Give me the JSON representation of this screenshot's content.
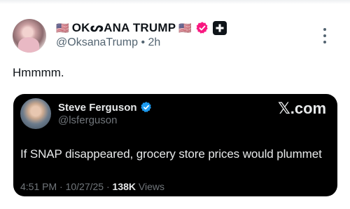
{
  "post": {
    "flag_left": "🇺🇸",
    "display_name": "OKᔕANA TRUMP",
    "flag_right": "🇺🇸",
    "handle": "@OksanaTrump",
    "separator": " • ",
    "time": "2h",
    "text": "Hmmmm.",
    "colors": {
      "verified": "#f91880",
      "handle": "#536471"
    }
  },
  "quote": {
    "name": "Steve Ferguson",
    "handle": "@lsferguson",
    "brand": "𝕏.com",
    "text": "If SNAP disappeared, grocery store prices would plummet",
    "timestamp": "4:51 PM · 10/27/25 · ",
    "views_count": "138K",
    "views_label": " Views",
    "colors": {
      "background": "#000000",
      "verified": "#1d9bf0"
    }
  }
}
